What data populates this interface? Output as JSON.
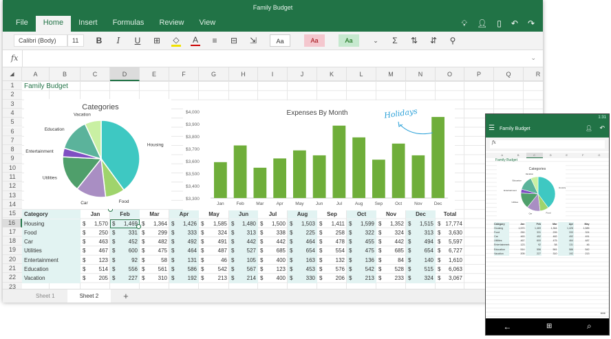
{
  "app": {
    "title": "Family Budget"
  },
  "tabs": [
    "File",
    "Home",
    "Insert",
    "Formulas",
    "Review",
    "View"
  ],
  "ribbon": {
    "font": "Calibri (Body)",
    "size": "11",
    "bold": "B",
    "italic": "I",
    "underline": "U",
    "style_normal": "Aa",
    "style_bad": "Aa",
    "style_good": "Aa",
    "sum": "Σ"
  },
  "formula": {
    "fx": "fx",
    "value": ""
  },
  "columns": [
    "A",
    "B",
    "C",
    "D",
    "E",
    "F",
    "G",
    "H",
    "I",
    "J",
    "K",
    "L",
    "M",
    "N",
    "O",
    "P",
    "Q",
    "R"
  ],
  "selected_col": "D",
  "selected_row": 16,
  "sheet_title": "Family Budget",
  "table": {
    "headers": [
      "Category",
      "Jan",
      "Feb",
      "Mar",
      "Apr",
      "May",
      "Jun",
      "Jul",
      "Aug",
      "Sep",
      "Oct",
      "Nov",
      "Dec",
      "Total"
    ],
    "currency": "$",
    "rows": [
      [
        "Housing",
        "1,570",
        "1,469",
        "1,364",
        "1,426",
        "1,585",
        "1,480",
        "1,500",
        "1,503",
        "1,411",
        "1,599",
        "1,352",
        "1,515",
        "17,774"
      ],
      [
        "Food",
        "250",
        "331",
        "299",
        "333",
        "324",
        "313",
        "338",
        "225",
        "258",
        "322",
        "324",
        "313",
        "3,630"
      ],
      [
        "Car",
        "463",
        "452",
        "482",
        "492",
        "491",
        "442",
        "442",
        "464",
        "478",
        "455",
        "442",
        "494",
        "5,597"
      ],
      [
        "Utilities",
        "467",
        "600",
        "475",
        "464",
        "487",
        "527",
        "685",
        "654",
        "554",
        "475",
        "685",
        "654",
        "6,727"
      ],
      [
        "Entertainment",
        "123",
        "92",
        "58",
        "131",
        "46",
        "105",
        "400",
        "163",
        "132",
        "136",
        "84",
        "140",
        "1,610"
      ],
      [
        "Education",
        "514",
        "556",
        "561",
        "586",
        "542",
        "567",
        "123",
        "453",
        "576",
        "542",
        "528",
        "515",
        "6,063"
      ],
      [
        "Vacation",
        "205",
        "227",
        "310",
        "192",
        "213",
        "214",
        "400",
        "330",
        "206",
        "213",
        "233",
        "324",
        "3,067"
      ]
    ]
  },
  "sheets": [
    "Sheet 1",
    "Sheet 2"
  ],
  "add_sheet": "+",
  "chart_data": [
    {
      "type": "pie",
      "title": "Categories",
      "labels": [
        "Housing",
        "Food",
        "Car",
        "Utilities",
        "Entertainment",
        "Education",
        "Vacation"
      ],
      "values": [
        17774,
        3630,
        5597,
        6727,
        1610,
        6063,
        3067
      ],
      "colors": [
        "#3ec8c2",
        "#9fd46c",
        "#a98ec3",
        "#4f9f6b",
        "#7f4fc2",
        "#5bb39b",
        "#c9f0a3"
      ]
    },
    {
      "type": "bar",
      "title": "Expenses By Month",
      "categories": [
        "Jan",
        "Feb",
        "Mar",
        "Apr",
        "May",
        "Jun",
        "Jul",
        "Aug",
        "Sep",
        "Oct",
        "Nov",
        "Dec"
      ],
      "values": [
        3590,
        3725,
        3545,
        3620,
        3685,
        3645,
        3885,
        3790,
        3610,
        3740,
        3645,
        3955
      ],
      "ylim": [
        3300,
        4000
      ],
      "yticks": [
        "$3,300",
        "$3,400",
        "$3,500",
        "$3,600",
        "$3,700",
        "$3,800",
        "$3,900",
        "$4,000"
      ],
      "annotation": "Holidays",
      "color": "#6fae3a"
    }
  ],
  "phone": {
    "time": "1:31",
    "title": "Family Budget",
    "nav_back": "←",
    "nav_search": "⌕"
  }
}
